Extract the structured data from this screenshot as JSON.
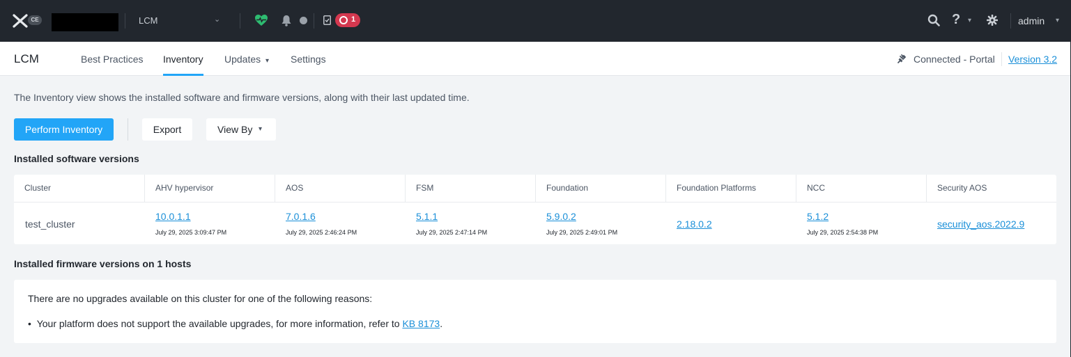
{
  "topbar": {
    "logo_badge": "CE",
    "app_selector": "LCM",
    "alert_count": "1",
    "user": "admin",
    "icons": [
      "nutanix-x-icon",
      "health-heart-icon",
      "bell-icon",
      "task-icon",
      "alert-icon",
      "search-icon",
      "help-icon",
      "gear-icon"
    ],
    "colors": {
      "background": "#22272e",
      "health": "#2ebc71",
      "alert": "#d4384f"
    }
  },
  "subnav": {
    "title": "LCM",
    "tabs": [
      {
        "label": "Best Practices"
      },
      {
        "label": "Inventory"
      },
      {
        "label": "Updates"
      },
      {
        "label": "Settings"
      }
    ],
    "active_tab": "Inventory",
    "connection_status": "Connected - Portal",
    "version_link": "Version 3.2"
  },
  "main": {
    "description": "The Inventory view shows the installed software and firmware versions, along with their last updated time.",
    "buttons": {
      "perform_inventory": "Perform Inventory",
      "export": "Export",
      "view_by": "View By"
    },
    "software_title": "Installed software versions",
    "table": {
      "headers": [
        "Cluster",
        "AHV hypervisor",
        "AOS",
        "FSM",
        "Foundation",
        "Foundation Platforms",
        "NCC",
        "Security AOS"
      ],
      "row": {
        "cluster": "test_cluster",
        "cells": [
          {
            "version": "10.0.1.1",
            "date": "July 29, 2025 3:09:47 PM"
          },
          {
            "version": "7.0.1.6",
            "date": "July 29, 2025 2:46:24 PM"
          },
          {
            "version": "5.1.1",
            "date": "July 29, 2025 2:47:14 PM"
          },
          {
            "version": "5.9.0.2",
            "date": "July 29, 2025 2:49:01 PM"
          },
          {
            "version": "2.18.0.2",
            "date": ""
          },
          {
            "version": "5.1.2",
            "date": "July 29, 2025 2:54:38 PM"
          },
          {
            "version": "security_aos.2022.9",
            "date": ""
          }
        ]
      }
    },
    "firmware_title": "Installed firmware versions on 1 hosts",
    "firmware_message": "There are no upgrades available on this cluster for one of the following reasons:",
    "firmware_bullet_prefix": "Your platform does not support the available upgrades, for more information, refer to ",
    "firmware_bullet_link": "KB 8173",
    "firmware_bullet_suffix": "."
  }
}
